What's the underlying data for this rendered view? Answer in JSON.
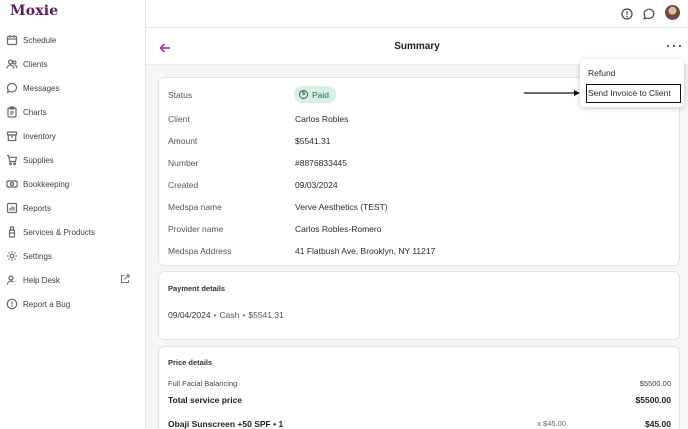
{
  "brand": {
    "logo": "Moxie"
  },
  "sidebar": {
    "items": [
      {
        "label": "Schedule",
        "icon": "calendar-icon"
      },
      {
        "label": "Clients",
        "icon": "users-icon"
      },
      {
        "label": "Messages",
        "icon": "chat-icon"
      },
      {
        "label": "Charts",
        "icon": "clipboard-icon"
      },
      {
        "label": "Inventory",
        "icon": "box-icon"
      },
      {
        "label": "Supplies",
        "icon": "cart-icon"
      },
      {
        "label": "Bookkeeping",
        "icon": "money-icon"
      },
      {
        "label": "Reports",
        "icon": "report-icon"
      },
      {
        "label": "Services & Products",
        "icon": "bottle-icon"
      },
      {
        "label": "Settings",
        "icon": "gear-icon"
      },
      {
        "label": "Help Desk",
        "icon": "help-user-icon",
        "external": true
      },
      {
        "label": "Report a Bug",
        "icon": "alert-circle-icon"
      }
    ]
  },
  "header": {
    "title": "Summary"
  },
  "summary": {
    "status_label": "Status",
    "status_value": "Paid",
    "client_label": "Client",
    "client_value": "Carlos Robles",
    "amount_label": "Amount",
    "amount_value": "$5541.31",
    "number_label": "Number",
    "number_value": "#8876833445",
    "created_label": "Created",
    "created_value": "09/03/2024",
    "medspa_label": "Medspa name",
    "medspa_value": "Verve Aesthetics (TEST)",
    "provider_label": "Provider name",
    "provider_value": "Carlos Robles-Romero",
    "address_label": "Medspa Address",
    "address_value": "41 Flatbush Ave, Brooklyn, NY 11217"
  },
  "payment": {
    "heading": "Payment details",
    "date": "09/04/2024",
    "method": "Cash",
    "amount": "$5541.31"
  },
  "price": {
    "heading": "Price details",
    "service_name": "Full Facial Balancing",
    "service_price": "$5500.00",
    "total_service_label": "Total service price",
    "total_service_value": "$5500.00",
    "product_name": "Obaji Sunscreen +50 SPF • 1",
    "product_qty_price": "x $45.00",
    "product_total": "$45.00"
  },
  "menu": {
    "items": [
      "Refund",
      "Send Invoice to Client"
    ]
  },
  "colors": {
    "brand": "#5a1a5e",
    "accent": "#8e2c93",
    "paid_badge_bg": "#d8f0e3",
    "paid_badge_text": "#2d6b4b"
  }
}
